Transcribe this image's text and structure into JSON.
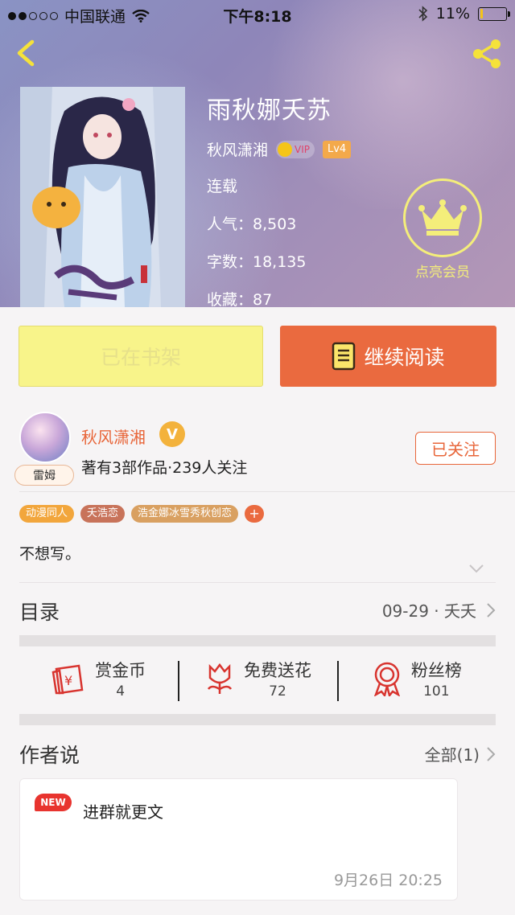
{
  "status_bar": {
    "carrier": "中国联通",
    "time": "下午8:18",
    "battery": "11%",
    "battery_level": 0.11
  },
  "book": {
    "title": "雨秋娜夭苏",
    "author": "秋风潇湘",
    "vip_label": "VIP",
    "level_label": "Lv4",
    "status": "连载",
    "popularity": "人气：8,503",
    "word_count": "字数：18,135",
    "favorites": "收藏：87"
  },
  "member": {
    "label": "点亮会员"
  },
  "actions": {
    "shelf_label": "已在书架",
    "read_label": "继续阅读"
  },
  "author_card": {
    "avatar_tag": "雷姆",
    "name": "秋风潇湘",
    "verified_label": "V",
    "stats": "著有3部作品·239人关注",
    "follow_label": "已关注"
  },
  "tags": [
    "动漫同人",
    "夭浩恋",
    "浩金娜冰雪秀秋创恋"
  ],
  "tag_add_label": "+",
  "description": "不想写。",
  "toc": {
    "title": "目录",
    "latest": "09-29 · 夭夭"
  },
  "stats": [
    {
      "label": "赏金币",
      "count": "4",
      "icon": "coin-envelope-icon"
    },
    {
      "label": "免费送花",
      "count": "72",
      "icon": "flower-icon"
    },
    {
      "label": "粉丝榜",
      "count": "101",
      "icon": "ribbon-medal-icon"
    }
  ],
  "author_talk": {
    "title": "作者说",
    "all_label": "全部(1)",
    "post": {
      "badge": "NEW",
      "text": "进群就更文",
      "time": "9月26日  20:25"
    }
  },
  "colors": {
    "accent_orange": "#ea6a3f",
    "shelf_yellow": "#f8f48a",
    "member_yellow": "#f4ee7a",
    "new_red": "#e8342f"
  }
}
